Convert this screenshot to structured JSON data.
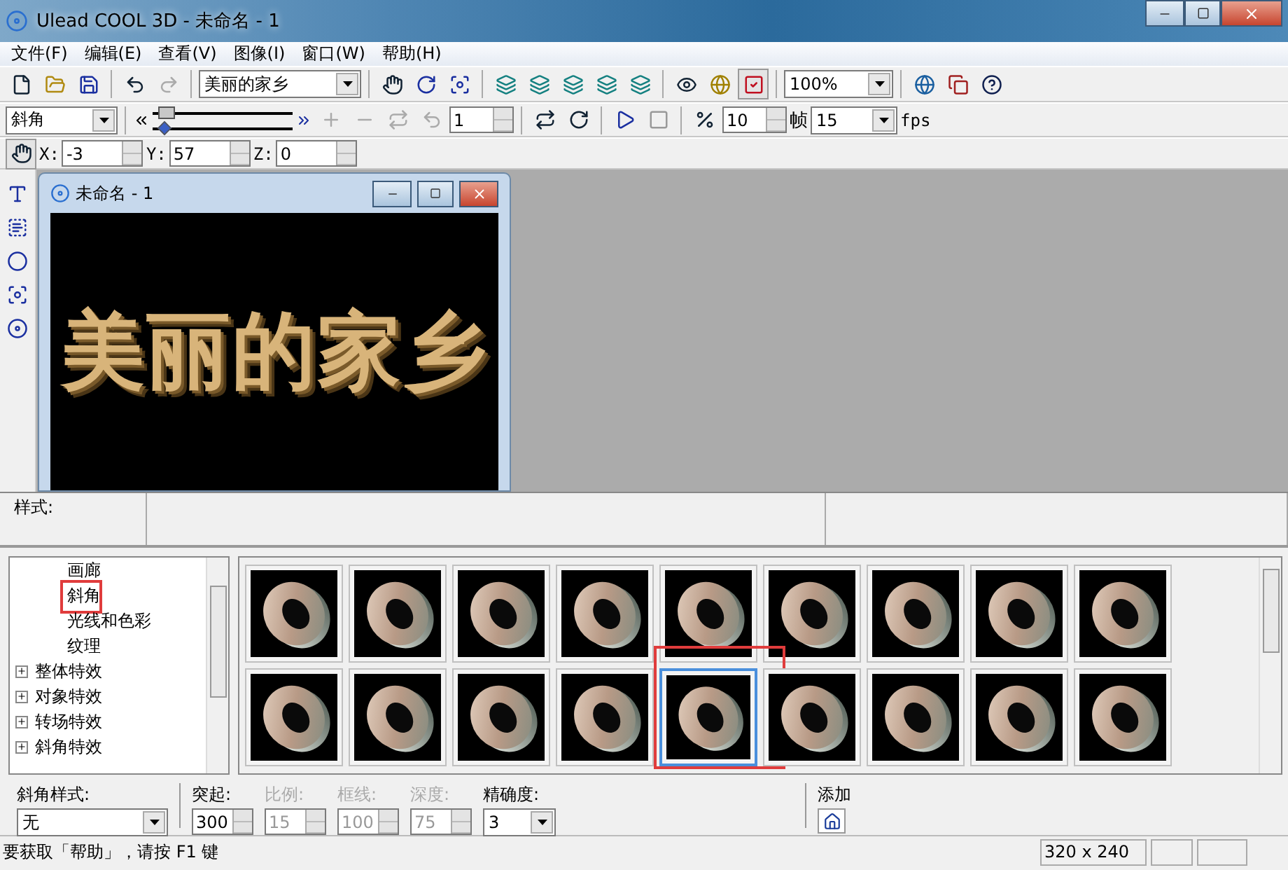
{
  "window": {
    "title": "Ulead COOL 3D - 未命名 - 1"
  },
  "menu": [
    {
      "label": "文件(F)"
    },
    {
      "label": "编辑(E)"
    },
    {
      "label": "查看(V)"
    },
    {
      "label": "图像(I)"
    },
    {
      "label": "窗口(W)"
    },
    {
      "label": "帮助(H)"
    }
  ],
  "toolbar": {
    "text_combo": "美丽的家乡",
    "zoom_combo": "100%"
  },
  "animation_bar": {
    "attribute_combo": "斜角",
    "sliders": [
      {
        "level": 0.04
      },
      {
        "level": 0.04
      }
    ],
    "frame_field": "1",
    "speed_field": "10",
    "frame_label": "帧",
    "fps_combo": "15",
    "fps_label": "fps"
  },
  "position_bar": {
    "fields": [
      {
        "label": "X:",
        "value": "-3"
      },
      {
        "label": "Y:",
        "value": "57"
      },
      {
        "label": "Z:",
        "value": "0"
      }
    ]
  },
  "document": {
    "title": "未命名 - 1",
    "canvas_text": "美丽的家乡"
  },
  "style_bar": {
    "label": "样式:"
  },
  "tree": [
    {
      "children": [
        {
          "label": "画廊",
          "selected": false,
          "marked": false
        },
        {
          "label": "斜角",
          "selected": false,
          "marked": true
        },
        {
          "label": "光线和色彩",
          "selected": false,
          "marked": false
        },
        {
          "label": "纹理",
          "selected": false,
          "marked": false
        }
      ]
    },
    {
      "label": "整体特效",
      "expanded": false
    },
    {
      "label": "对象特效",
      "expanded": false
    },
    {
      "label": "转场特效",
      "expanded": false
    },
    {
      "label": "斜角特效",
      "expanded": false
    }
  ],
  "gallery": [
    {
      "selected": false,
      "marked": false
    },
    {
      "selected": false,
      "marked": false
    },
    {
      "selected": false,
      "marked": false
    },
    {
      "selected": false,
      "marked": false
    },
    {
      "selected": false,
      "marked": false
    },
    {
      "selected": false,
      "marked": false
    },
    {
      "selected": false,
      "marked": false
    },
    {
      "selected": false,
      "marked": false
    },
    {
      "selected": false,
      "marked": false
    },
    {
      "selected": false,
      "marked": false
    },
    {
      "selected": false,
      "marked": false
    },
    {
      "selected": false,
      "marked": false
    },
    {
      "selected": false,
      "marked": false
    },
    {
      "selected": true,
      "marked": true
    },
    {
      "selected": false,
      "marked": false
    },
    {
      "selected": false,
      "marked": false
    },
    {
      "selected": false,
      "marked": false
    },
    {
      "selected": false,
      "marked": false
    }
  ],
  "properties": {
    "bevel_style": {
      "label": "斜角样式:",
      "value": "无"
    },
    "spinners": [
      {
        "label": "突起:",
        "value": "300",
        "disabled": false
      },
      {
        "label": "比例:",
        "value": "15",
        "disabled": true
      },
      {
        "label": "框线:",
        "value": "100",
        "disabled": true
      },
      {
        "label": "深度:",
        "value": "75",
        "disabled": true
      }
    ],
    "precision": {
      "label": "精确度:",
      "value": "3"
    },
    "add": {
      "label": "添加"
    }
  },
  "status_bar": {
    "message": "要获取「帮助」，请按 F1 键",
    "size": "320 x 240"
  }
}
